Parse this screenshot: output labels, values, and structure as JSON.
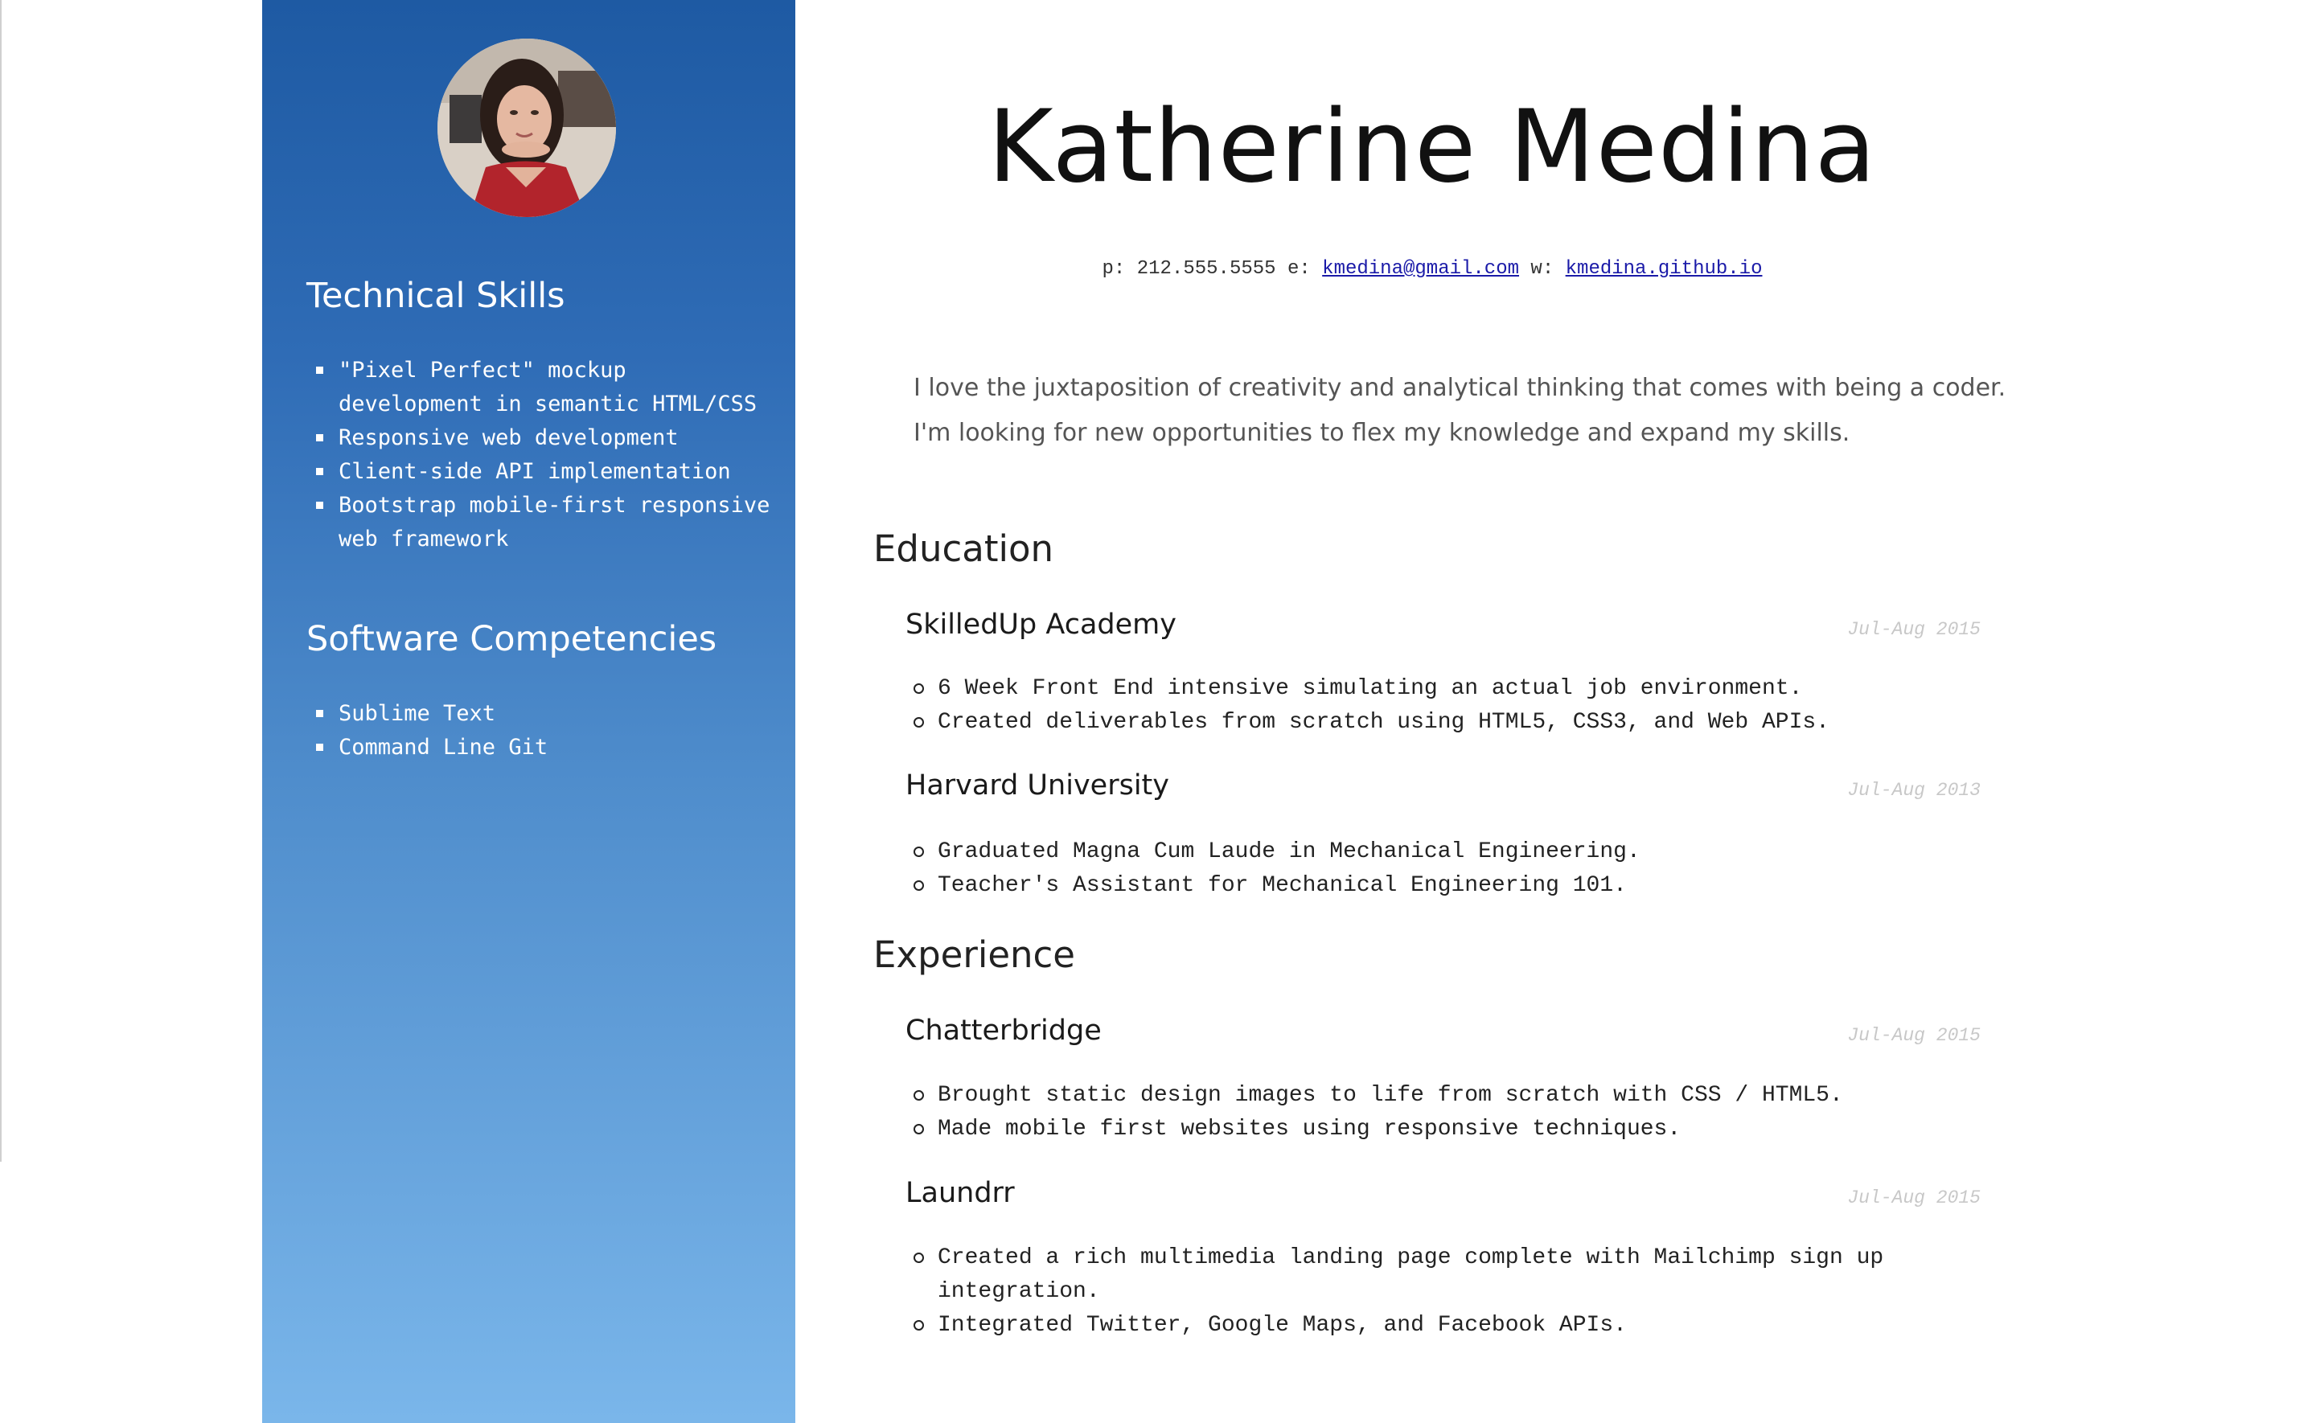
{
  "profile": {
    "name": "Katherine Medina",
    "photo_alt": "Katherine Medina profile photo"
  },
  "contact": {
    "phone_label": "p:",
    "phone": "212.555.5555",
    "email_label": "e:",
    "email": "kmedina@gmail.com",
    "web_label": "w:",
    "website": "kmedina.github.io"
  },
  "summary": {
    "line1": "I love the juxtaposition of creativity and analytical thinking that comes with being a coder.",
    "line2": "I'm looking for new opportunities to flex my knowledge and expand my skills."
  },
  "sidebar": {
    "technical_title": "Technical Skills",
    "technical_items": [
      "\"Pixel Perfect\" mockup development in semantic HTML/CSS",
      "Responsive web development",
      "Client-side API implementation",
      "Bootstrap mobile-first responsive web framework"
    ],
    "software_title": "Software Competencies",
    "software_items": [
      "Sublime Text",
      "Command Line Git"
    ]
  },
  "education": {
    "title": "Education",
    "entries": [
      {
        "name": "SkilledUp Academy",
        "date": "Jul-Aug 2015",
        "bullets": [
          "6 Week Front End intensive simulating an actual job environment.",
          "Created deliverables from scratch using HTML5, CSS3, and Web APIs."
        ]
      },
      {
        "name": "Harvard University",
        "date": "Jul-Aug 2013",
        "bullets": [
          "Graduated Magna Cum Laude in Mechanical Engineering.",
          "Teacher's Assistant for Mechanical Engineering 101."
        ]
      }
    ]
  },
  "experience": {
    "title": "Experience",
    "entries": [
      {
        "name": "Chatterbridge",
        "date": "Jul-Aug 2015",
        "bullets": [
          "Brought static design images to life from scratch with CSS / HTML5.",
          "Made mobile first websites using responsive techniques."
        ]
      },
      {
        "name": "Laundrr",
        "date": "Jul-Aug 2015",
        "bullets": [
          "Created a rich multimedia landing page complete with Mailchimp sign up integration.",
          "Integrated Twitter, Google Maps, and Facebook APIs."
        ]
      }
    ]
  },
  "colors": {
    "sidebar_top": "#1e5aa3",
    "sidebar_bottom": "#7ab6ea",
    "link": "#1a1aa8",
    "date_text": "#c8c8c8"
  }
}
